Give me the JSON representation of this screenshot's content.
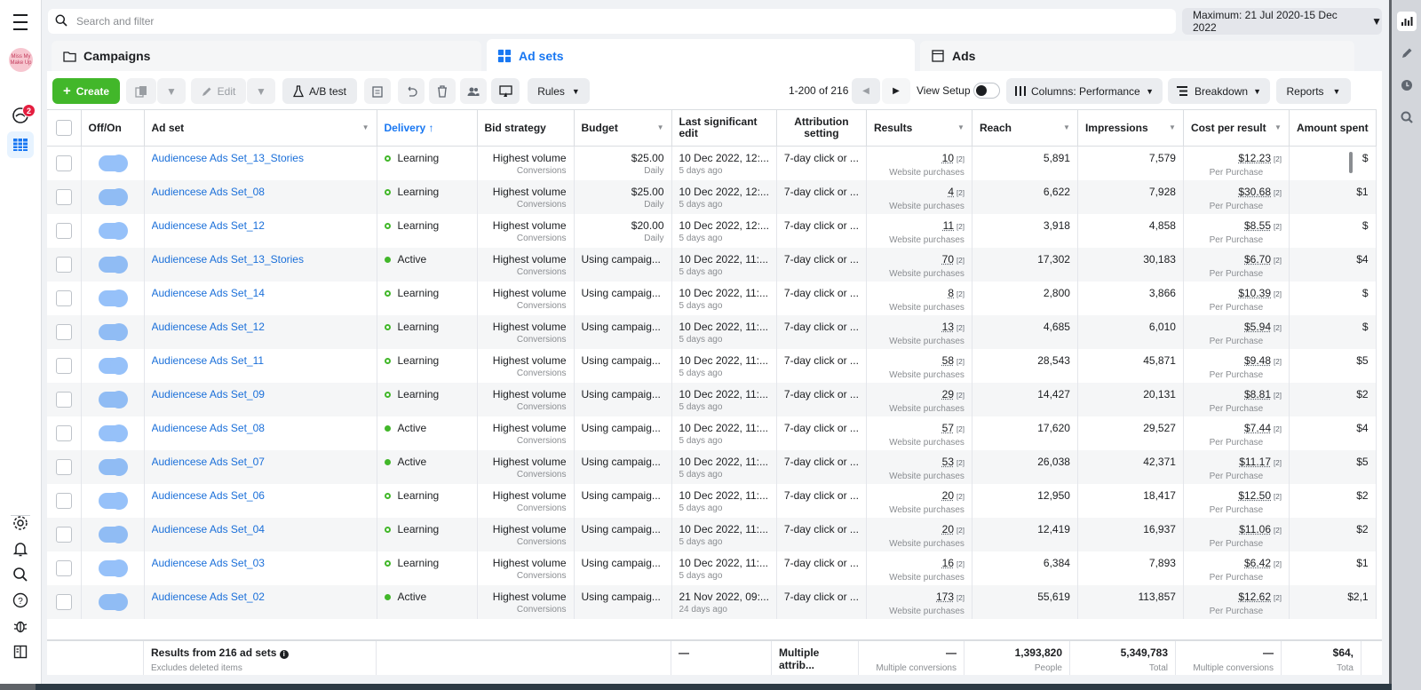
{
  "search": {
    "placeholder": "Search and filter"
  },
  "date_range": {
    "label": "Maximum: 21 Jul 2020-15 Dec 2022"
  },
  "notifications_count": "2",
  "avatar_text": "Miss My Make Up",
  "tabs": [
    {
      "label": "Campaigns"
    },
    {
      "label": "Ad sets"
    },
    {
      "label": "Ads"
    }
  ],
  "toolbar": {
    "create_label": "Create",
    "edit_label": "Edit",
    "ab_test_label": "A/B test",
    "rules_label": "Rules",
    "pagination": "1-200 of 216",
    "view_setup_label": "View Setup",
    "columns_label": "Columns: Performance",
    "breakdown_label": "Breakdown",
    "reports_label": "Reports"
  },
  "columns": {
    "off_on": "Off/On",
    "ad_set": "Ad set",
    "delivery": "Delivery ↑",
    "bid_strategy": "Bid strategy",
    "budget": "Budget",
    "last_edit": "Last significant edit",
    "attribution": "Attribution setting",
    "results": "Results",
    "reach": "Reach",
    "impressions": "Impressions",
    "cost_per_result": "Cost per result",
    "amount_spent": "Amount spent"
  },
  "rows": [
    {
      "name": "Audiencese Ads Set_13_Stories",
      "delivery": "Learning",
      "delivery_type": "learning",
      "bid": "Highest volume",
      "bid_sub": "Conversions",
      "budget": "$25.00",
      "budget_sub": "Daily",
      "edit": "10 Dec 2022, 12:...",
      "edit_sub": "5 days ago",
      "attribution": "7-day click or ...",
      "results": "10",
      "results_sub": "Website purchases",
      "reach": "5,891",
      "impressions": "7,579",
      "cpr": "$12.23",
      "cpr_sub": "Per Purchase",
      "spent": "$"
    },
    {
      "name": "Audiencese Ads Set_08",
      "delivery": "Learning",
      "delivery_type": "learning",
      "bid": "Highest volume",
      "bid_sub": "Conversions",
      "budget": "$25.00",
      "budget_sub": "Daily",
      "edit": "10 Dec 2022, 12:...",
      "edit_sub": "5 days ago",
      "attribution": "7-day click or ...",
      "results": "4",
      "results_sub": "Website purchases",
      "reach": "6,622",
      "impressions": "7,928",
      "cpr": "$30.68",
      "cpr_sub": "Per Purchase",
      "spent": "$1"
    },
    {
      "name": "Audiencese Ads Set_12",
      "delivery": "Learning",
      "delivery_type": "learning",
      "bid": "Highest volume",
      "bid_sub": "Conversions",
      "budget": "$20.00",
      "budget_sub": "Daily",
      "edit": "10 Dec 2022, 12:...",
      "edit_sub": "5 days ago",
      "attribution": "7-day click or ...",
      "results": "11",
      "results_sub": "Website purchases",
      "reach": "3,918",
      "impressions": "4,858",
      "cpr": "$8.55",
      "cpr_sub": "Per Purchase",
      "spent": "$"
    },
    {
      "name": "Audiencese Ads Set_13_Stories",
      "delivery": "Active",
      "delivery_type": "active",
      "bid": "Highest volume",
      "bid_sub": "Conversions",
      "budget": "Using campaig...",
      "budget_sub": "",
      "edit": "10 Dec 2022, 11:...",
      "edit_sub": "5 days ago",
      "attribution": "7-day click or ...",
      "results": "70",
      "results_sub": "Website purchases",
      "reach": "17,302",
      "impressions": "30,183",
      "cpr": "$6.70",
      "cpr_sub": "Per Purchase",
      "spent": "$4"
    },
    {
      "name": "Audiencese Ads Set_14",
      "delivery": "Learning",
      "delivery_type": "learning",
      "bid": "Highest volume",
      "bid_sub": "Conversions",
      "budget": "Using campaig...",
      "budget_sub": "",
      "edit": "10 Dec 2022, 11:...",
      "edit_sub": "5 days ago",
      "attribution": "7-day click or ...",
      "results": "8",
      "results_sub": "Website purchases",
      "reach": "2,800",
      "impressions": "3,866",
      "cpr": "$10.39",
      "cpr_sub": "Per Purchase",
      "spent": "$"
    },
    {
      "name": "Audiencese Ads Set_12",
      "delivery": "Learning",
      "delivery_type": "learning",
      "bid": "Highest volume",
      "bid_sub": "Conversions",
      "budget": "Using campaig...",
      "budget_sub": "",
      "edit": "10 Dec 2022, 11:...",
      "edit_sub": "5 days ago",
      "attribution": "7-day click or ...",
      "results": "13",
      "results_sub": "Website purchases",
      "reach": "4,685",
      "impressions": "6,010",
      "cpr": "$5.94",
      "cpr_sub": "Per Purchase",
      "spent": "$"
    },
    {
      "name": "Audiencese Ads Set_11",
      "delivery": "Learning",
      "delivery_type": "learning",
      "bid": "Highest volume",
      "bid_sub": "Conversions",
      "budget": "Using campaig...",
      "budget_sub": "",
      "edit": "10 Dec 2022, 11:...",
      "edit_sub": "5 days ago",
      "attribution": "7-day click or ...",
      "results": "58",
      "results_sub": "Website purchases",
      "reach": "28,543",
      "impressions": "45,871",
      "cpr": "$9.48",
      "cpr_sub": "Per Purchase",
      "spent": "$5"
    },
    {
      "name": "Audiencese Ads Set_09",
      "delivery": "Learning",
      "delivery_type": "learning",
      "bid": "Highest volume",
      "bid_sub": "Conversions",
      "budget": "Using campaig...",
      "budget_sub": "",
      "edit": "10 Dec 2022, 11:...",
      "edit_sub": "5 days ago",
      "attribution": "7-day click or ...",
      "results": "29",
      "results_sub": "Website purchases",
      "reach": "14,427",
      "impressions": "20,131",
      "cpr": "$8.81",
      "cpr_sub": "Per Purchase",
      "spent": "$2"
    },
    {
      "name": "Audiencese Ads Set_08",
      "delivery": "Active",
      "delivery_type": "active",
      "bid": "Highest volume",
      "bid_sub": "Conversions",
      "budget": "Using campaig...",
      "budget_sub": "",
      "edit": "10 Dec 2022, 11:...",
      "edit_sub": "5 days ago",
      "attribution": "7-day click or ...",
      "results": "57",
      "results_sub": "Website purchases",
      "reach": "17,620",
      "impressions": "29,527",
      "cpr": "$7.44",
      "cpr_sub": "Per Purchase",
      "spent": "$4"
    },
    {
      "name": "Audiencese Ads Set_07",
      "delivery": "Active",
      "delivery_type": "active",
      "bid": "Highest volume",
      "bid_sub": "Conversions",
      "budget": "Using campaig...",
      "budget_sub": "",
      "edit": "10 Dec 2022, 11:...",
      "edit_sub": "5 days ago",
      "attribution": "7-day click or ...",
      "results": "53",
      "results_sub": "Website purchases",
      "reach": "26,038",
      "impressions": "42,371",
      "cpr": "$11.17",
      "cpr_sub": "Per Purchase",
      "spent": "$5"
    },
    {
      "name": "Audiencese Ads Set_06",
      "delivery": "Learning",
      "delivery_type": "learning",
      "bid": "Highest volume",
      "bid_sub": "Conversions",
      "budget": "Using campaig...",
      "budget_sub": "",
      "edit": "10 Dec 2022, 11:...",
      "edit_sub": "5 days ago",
      "attribution": "7-day click or ...",
      "results": "20",
      "results_sub": "Website purchases",
      "reach": "12,950",
      "impressions": "18,417",
      "cpr": "$12.50",
      "cpr_sub": "Per Purchase",
      "spent": "$2"
    },
    {
      "name": "Audiencese Ads Set_04",
      "delivery": "Learning",
      "delivery_type": "learning",
      "bid": "Highest volume",
      "bid_sub": "Conversions",
      "budget": "Using campaig...",
      "budget_sub": "",
      "edit": "10 Dec 2022, 11:...",
      "edit_sub": "5 days ago",
      "attribution": "7-day click or ...",
      "results": "20",
      "results_sub": "Website purchases",
      "reach": "12,419",
      "impressions": "16,937",
      "cpr": "$11.06",
      "cpr_sub": "Per Purchase",
      "spent": "$2"
    },
    {
      "name": "Audiencese Ads Set_03",
      "delivery": "Learning",
      "delivery_type": "learning",
      "bid": "Highest volume",
      "bid_sub": "Conversions",
      "budget": "Using campaig...",
      "budget_sub": "",
      "edit": "10 Dec 2022, 11:...",
      "edit_sub": "5 days ago",
      "attribution": "7-day click or ...",
      "results": "16",
      "results_sub": "Website purchases",
      "reach": "6,384",
      "impressions": "7,893",
      "cpr": "$6.42",
      "cpr_sub": "Per Purchase",
      "spent": "$1"
    },
    {
      "name": "Audiencese Ads Set_02",
      "delivery": "Active",
      "delivery_type": "active",
      "bid": "Highest volume",
      "bid_sub": "Conversions",
      "budget": "Using campaig...",
      "budget_sub": "",
      "edit": "21 Nov 2022, 09:...",
      "edit_sub": "24 days ago",
      "attribution": "7-day click or ...",
      "results": "173",
      "results_sub": "Website purchases",
      "reach": "55,619",
      "impressions": "113,857",
      "cpr": "$12.62",
      "cpr_sub": "Per Purchase",
      "spent": "$2,1"
    }
  ],
  "summary": {
    "title": "Results from 216 ad sets",
    "subtitle": "Excludes deleted items",
    "last_edit": "—",
    "attribution": "Multiple attrib...",
    "results": "—",
    "results_sub": "Multiple conversions",
    "reach": "1,393,820",
    "reach_sub": "People",
    "impressions": "5,349,783",
    "impressions_sub": "Total",
    "cpr": "—",
    "cpr_sub": "Multiple conversions",
    "spent": "$64,",
    "spent_sub": "Tota"
  },
  "colors": {
    "accent": "#1877f2",
    "create": "#42b72a",
    "link": "#1a6fd9"
  },
  "icons": [
    "menu-icon",
    "notification-icon",
    "grid-icon",
    "settings-icon",
    "bell-icon",
    "search-icon",
    "help-icon",
    "bug-icon",
    "panel-icon",
    "chart-icon",
    "pencil-icon",
    "clock-icon",
    "zoom-icon"
  ]
}
